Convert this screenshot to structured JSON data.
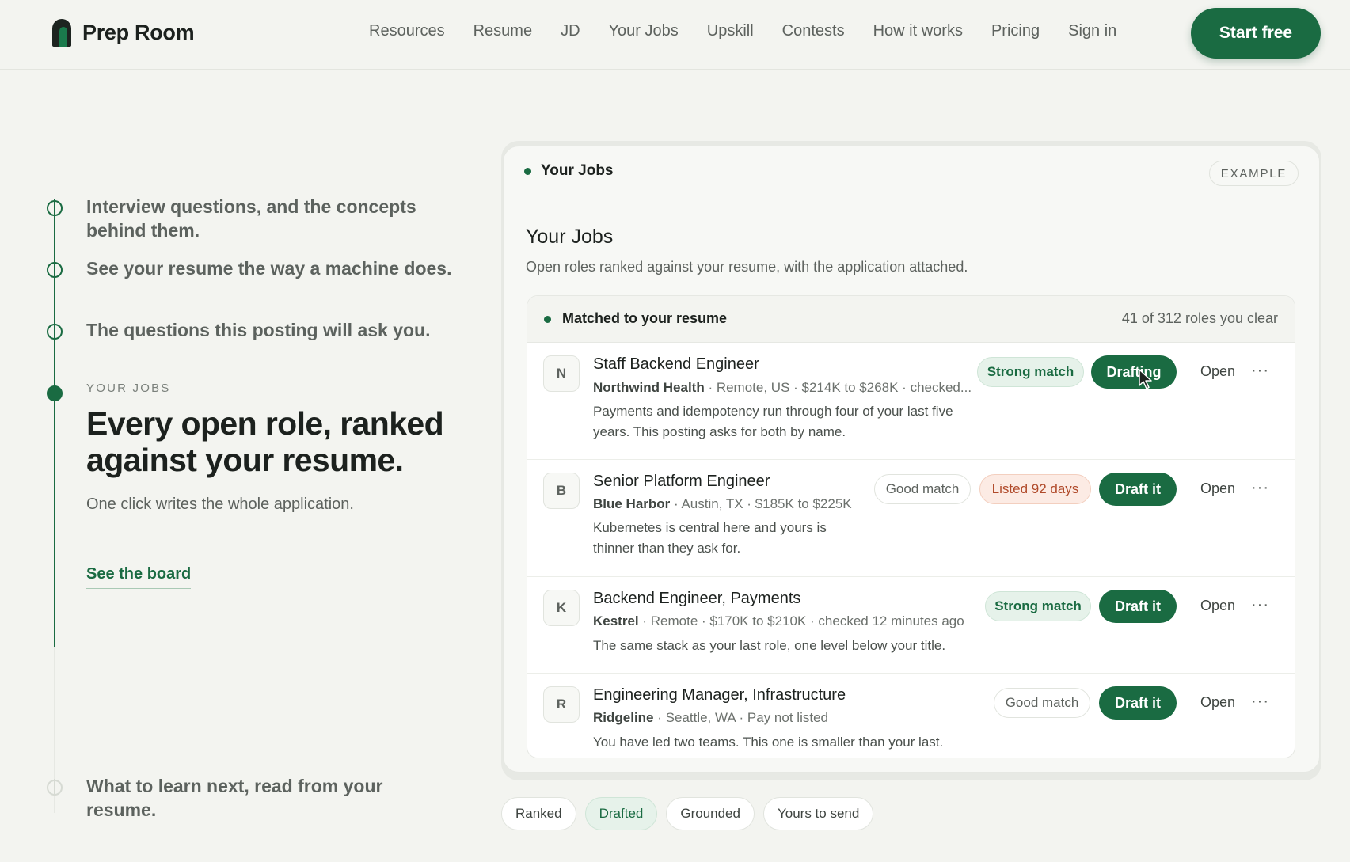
{
  "brand": {
    "name": "Prep Room"
  },
  "nav": {
    "links": [
      "Resources",
      "Resume",
      "JD",
      "Your Jobs",
      "Upskill",
      "Contests",
      "How it works",
      "Pricing",
      "Sign in"
    ],
    "cta": "Start free"
  },
  "steps": {
    "s1": "Interview questions, and the concepts behind them.",
    "s2": "See your resume the way a machine does.",
    "s3": "The questions this posting will ask you.",
    "s5": "What to learn next, read from your resume."
  },
  "feature": {
    "kicker": "YOUR JOBS",
    "headline": "Every open role, ranked against your resume.",
    "subline": "One click writes the whole application.",
    "link": "See the board"
  },
  "card": {
    "label": "Your Jobs",
    "badge": "EXAMPLE",
    "title": "Your Jobs",
    "description": "Open roles ranked against your resume, with the application attached.",
    "list_title": "Matched to your resume",
    "list_count": "41 of 312 roles you clear"
  },
  "jobs": [
    {
      "initial": "N",
      "title": "Staff Backend Engineer",
      "company": "Northwind Health",
      "meta": " · Remote, US · $214K to $268K · checked...",
      "note_line1": "Payments and idempotency run through four of your last five",
      "note_line2": "years. This posting asks for both by name.",
      "match": "Strong match",
      "action": "Drafting",
      "open": "Open",
      "more": "···"
    },
    {
      "initial": "B",
      "title": "Senior Platform Engineer",
      "company": "Blue Harbor",
      "meta": " · Austin, TX · $185K to $225K",
      "note_line1": "Kubernetes is central here and yours is",
      "note_line2": "thinner than they ask for.",
      "match": "Good match",
      "listed": "Listed 92 days",
      "action": "Draft it",
      "open": "Open",
      "more": "···"
    },
    {
      "initial": "K",
      "title": "Backend Engineer, Payments",
      "company": "Kestrel",
      "meta": " · Remote · $170K to $210K · checked 12 minutes ago",
      "note_line1": "The same stack as your last role, one level below your title.",
      "match": "Strong match",
      "action": "Draft it",
      "open": "Open",
      "more": "···"
    },
    {
      "initial": "R",
      "title": "Engineering Manager, Infrastructure",
      "company": "Ridgeline",
      "meta": " · Seattle, WA · Pay not listed",
      "note_line1": "You have led two teams. This one is smaller than your last.",
      "match": "Good match",
      "action": "Draft it",
      "open": "Open",
      "more": "···"
    }
  ],
  "tabs": [
    {
      "label": "Ranked",
      "active": false
    },
    {
      "label": "Drafted",
      "active": true
    },
    {
      "label": "Grounded",
      "active": false
    },
    {
      "label": "Yours to send",
      "active": false
    }
  ],
  "colors": {
    "accent": "#1a6b42",
    "background": "#f3f4f0",
    "listed": "#b04a2a"
  }
}
